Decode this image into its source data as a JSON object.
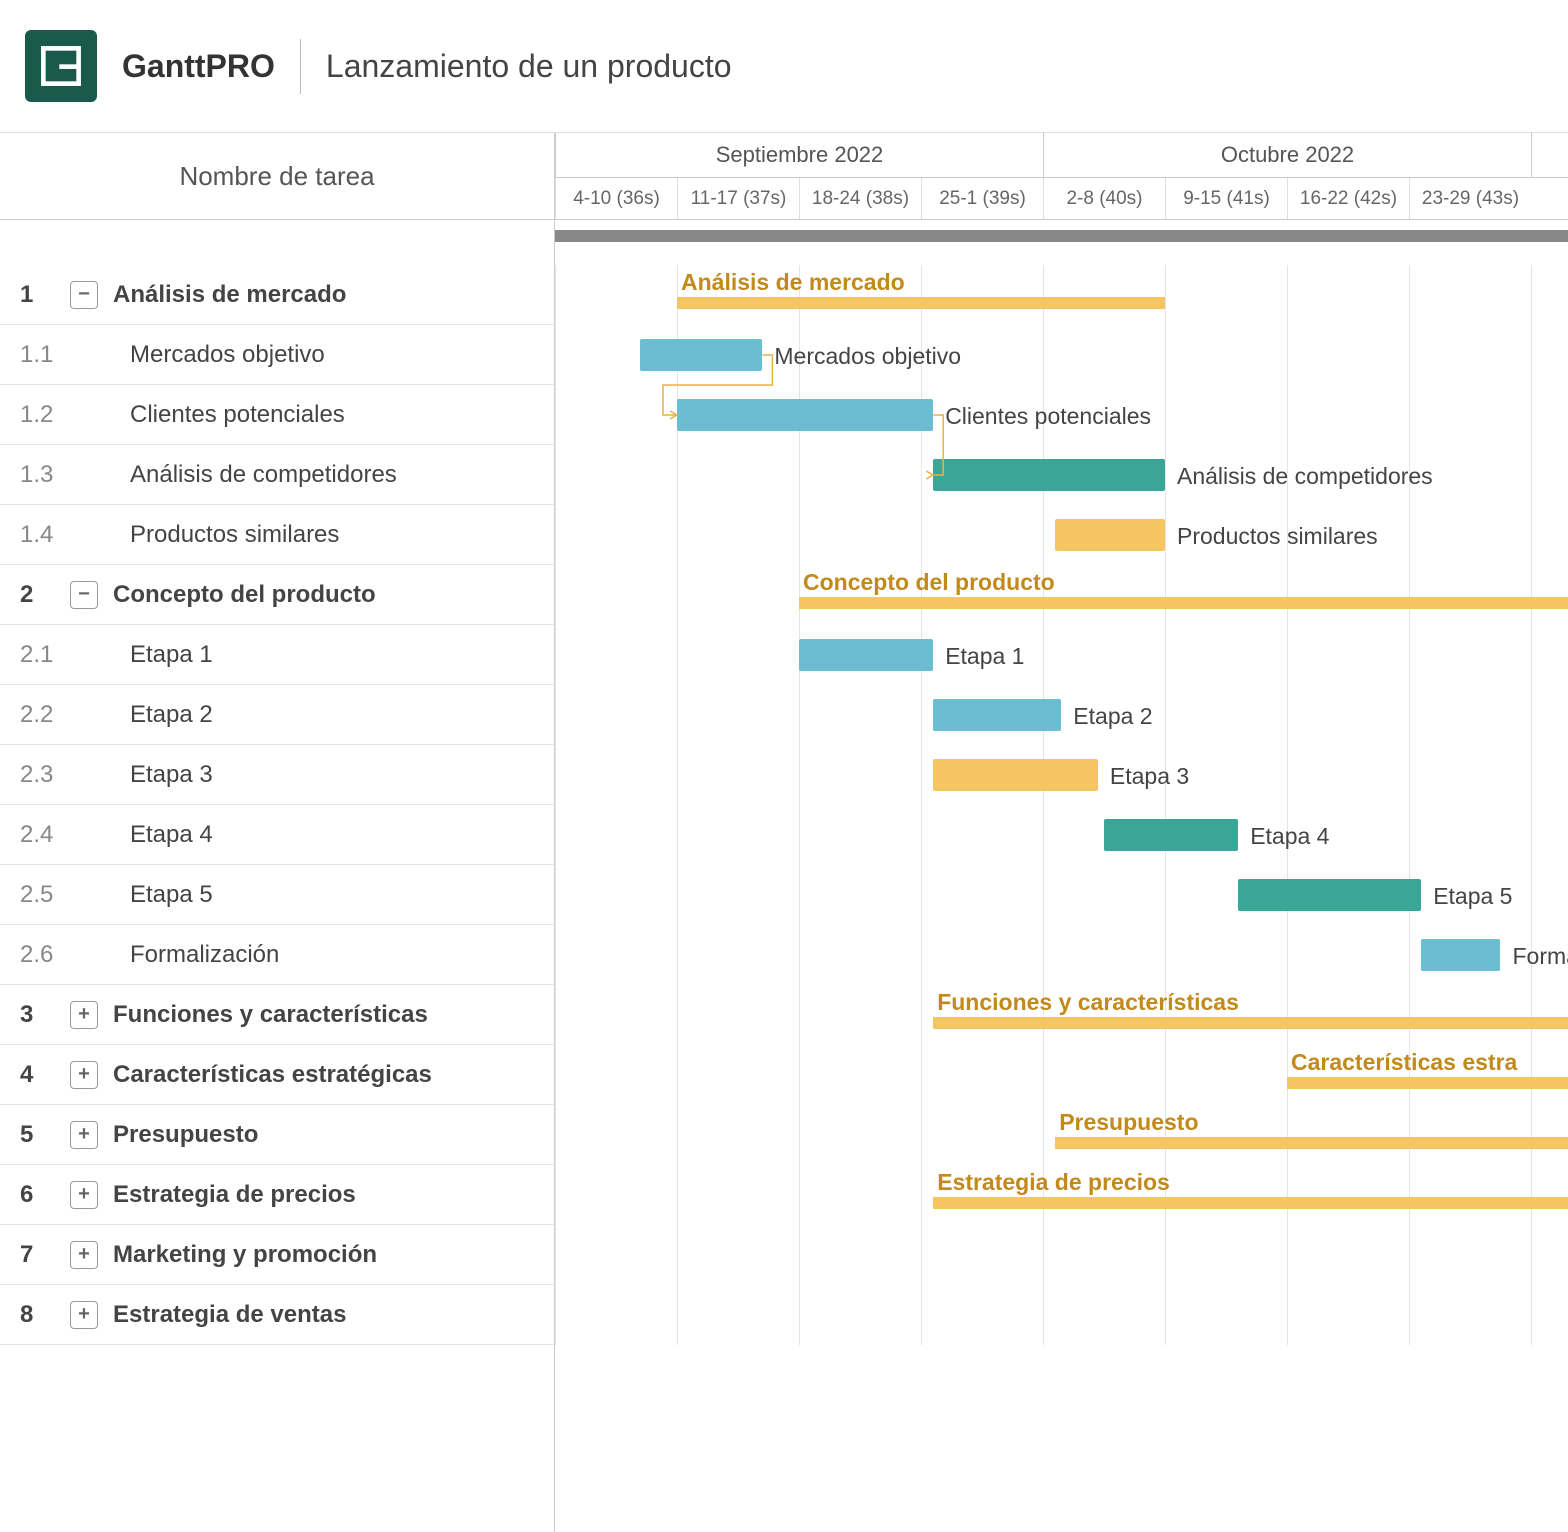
{
  "brand": "GanttPRO",
  "project_title": "Lanzamiento de un producto",
  "task_column_header": "Nombre de tarea",
  "months": [
    {
      "label": "Septiembre 2022",
      "span": 4
    },
    {
      "label": "Octubre 2022",
      "span": 4
    },
    {
      "label": "",
      "span": 1
    }
  ],
  "weeks": [
    {
      "label": "4-10 (36s)"
    },
    {
      "label": "11-17 (37s)"
    },
    {
      "label": "18-24 (38s)"
    },
    {
      "label": "25-1 (39s)"
    },
    {
      "label": "2-8 (40s)"
    },
    {
      "label": "9-15 (41s)"
    },
    {
      "label": "16-22 (42s)"
    },
    {
      "label": "23-29 (43s)"
    }
  ],
  "week_width": 122,
  "rows": [
    {
      "type": "group",
      "num": "1",
      "toggle": "−",
      "label": "Análisis de mercado",
      "bar_start": 1.0,
      "bar_end": 5.0,
      "label_start": 1.0
    },
    {
      "type": "sub",
      "num": "1.1",
      "label": "Mercados objetivo",
      "task_start": 0.7,
      "task_end": 1.7,
      "color": "blue",
      "conn_from_prev": true
    },
    {
      "type": "sub",
      "num": "1.2",
      "label": "Clientes potenciales",
      "task_start": 1.0,
      "task_end": 3.1,
      "color": "blue",
      "conn_from_prev": true
    },
    {
      "type": "sub",
      "num": "1.3",
      "label": "Análisis de competidores",
      "task_start": 3.1,
      "task_end": 5.0,
      "color": "teal",
      "conn_from_prev": true
    },
    {
      "type": "sub",
      "num": "1.4",
      "label": "Productos similares",
      "task_start": 4.1,
      "task_end": 5.0,
      "color": "orange"
    },
    {
      "type": "group",
      "num": "2",
      "toggle": "−",
      "label": "Concepto del producto",
      "bar_start": 2.0,
      "bar_end": 9.0,
      "label_start": 2.0
    },
    {
      "type": "sub",
      "num": "2.1",
      "label": "Etapa 1",
      "task_start": 2.0,
      "task_end": 3.1,
      "color": "blue"
    },
    {
      "type": "sub",
      "num": "2.2",
      "label": "Etapa 2",
      "task_start": 3.1,
      "task_end": 4.15,
      "color": "blue"
    },
    {
      "type": "sub",
      "num": "2.3",
      "label": "Etapa 3",
      "task_start": 3.1,
      "task_end": 4.45,
      "color": "orange"
    },
    {
      "type": "sub",
      "num": "2.4",
      "label": "Etapa 4",
      "task_start": 4.5,
      "task_end": 5.6,
      "color": "teal"
    },
    {
      "type": "sub",
      "num": "2.5",
      "label": "Etapa 5",
      "task_start": 5.6,
      "task_end": 7.1,
      "color": "teal"
    },
    {
      "type": "sub",
      "num": "2.6",
      "label": "Formalización",
      "task_start": 7.1,
      "task_end": 7.75,
      "color": "blue"
    },
    {
      "type": "group",
      "num": "3",
      "toggle": "+",
      "label": "Funciones y características",
      "bar_start": 3.1,
      "bar_end": 9.0,
      "label_start": 3.1
    },
    {
      "type": "group",
      "num": "4",
      "toggle": "+",
      "label": "Características estratégicas",
      "bar_start": 6.0,
      "bar_end": 9.0,
      "label_start": 6.0,
      "label_override": "Características estra"
    },
    {
      "type": "group",
      "num": "5",
      "toggle": "+",
      "label": "Presupuesto",
      "bar_start": 4.1,
      "bar_end": 9.0,
      "label_start": 4.1
    },
    {
      "type": "group",
      "num": "6",
      "toggle": "+",
      "label": "Estrategia de precios",
      "bar_start": 3.1,
      "bar_end": 9.0,
      "label_start": 3.1
    },
    {
      "type": "group",
      "num": "7",
      "toggle": "+",
      "label": "Marketing y promoción"
    },
    {
      "type": "group",
      "num": "8",
      "toggle": "+",
      "label": "Estrategia de ventas"
    }
  ]
}
